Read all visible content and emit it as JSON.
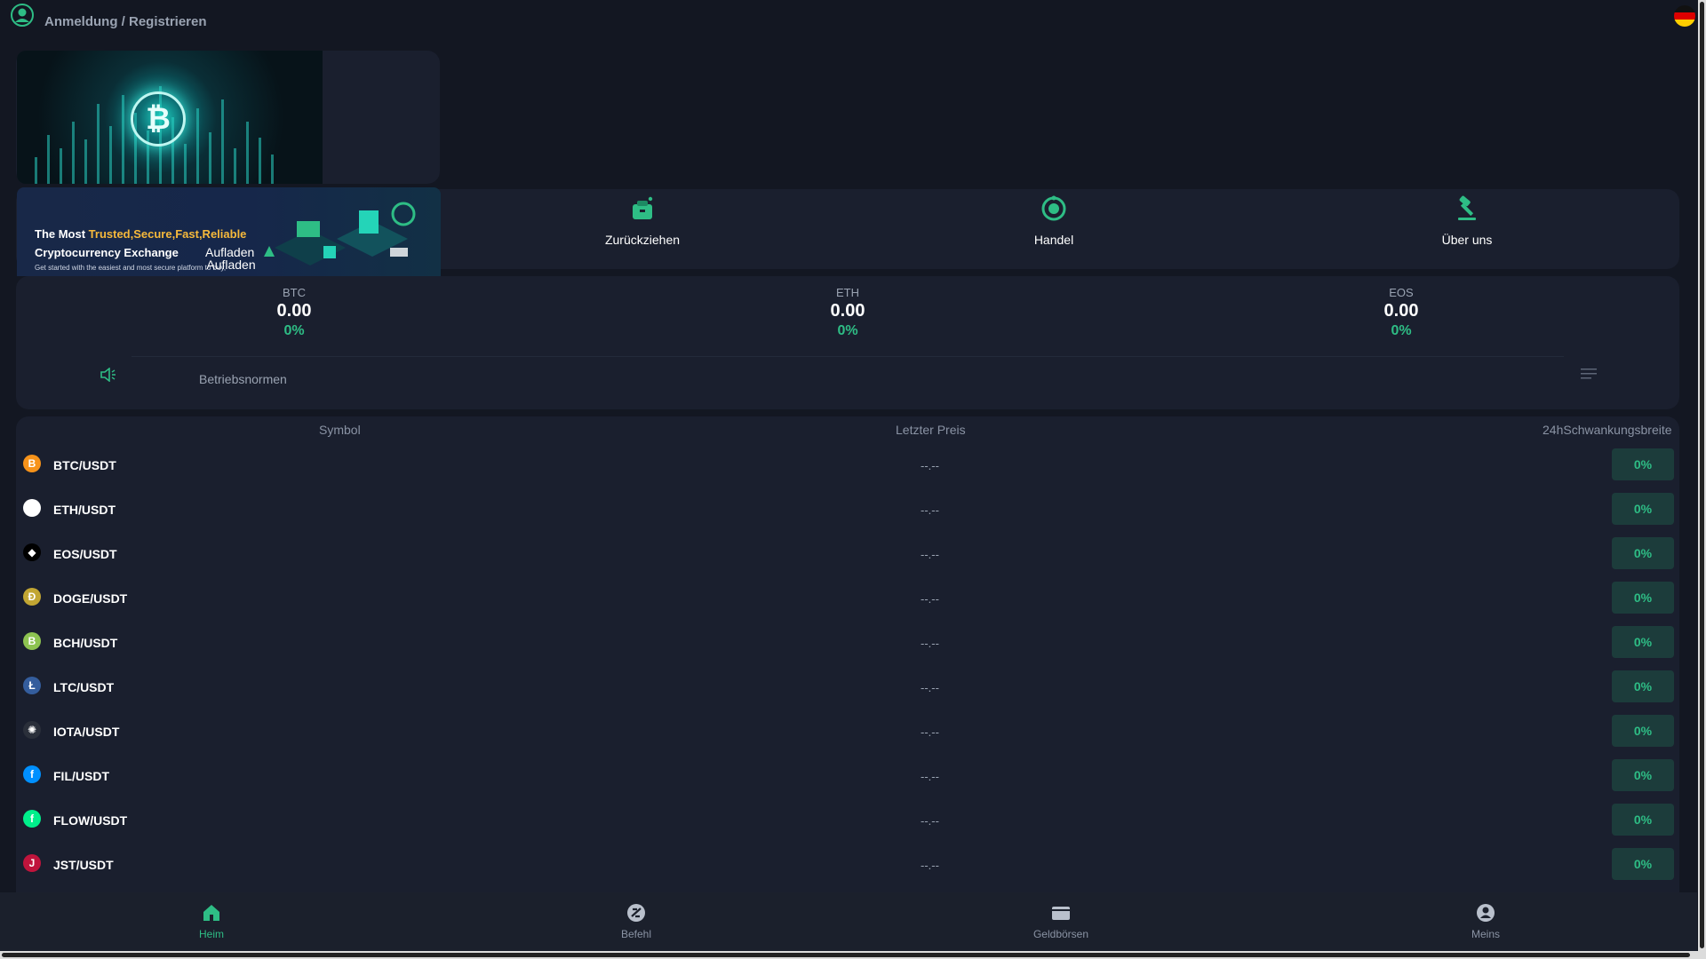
{
  "header": {
    "login_label": "Anmeldung / Registrieren",
    "avatar_icon": "user-circle-icon",
    "language_flag": "german-flag-icon"
  },
  "promo": {
    "line1_prefix": "The Most ",
    "line1_highlight": "Trusted,Secure,Fast,Reliable",
    "line2": "Cryptocurrency Exchange",
    "line3": "Get started with the easiest and most secure platform to buy,"
  },
  "quick_actions": [
    {
      "label": "Aufladen",
      "icon": "rocket-icon"
    },
    {
      "label": "Zurückziehen",
      "icon": "wallet-withdraw-icon"
    },
    {
      "label": "Handel",
      "icon": "trade-cycle-icon"
    },
    {
      "label": "Über uns",
      "icon": "hammer-icon"
    }
  ],
  "ticker": [
    {
      "symbol": "BTC",
      "price": "0.00",
      "change": "0%"
    },
    {
      "symbol": "ETH",
      "price": "0.00",
      "change": "0%"
    },
    {
      "symbol": "EOS",
      "price": "0.00",
      "change": "0%"
    }
  ],
  "notice": {
    "text": "Betriebsnormen",
    "icon": "speaker-icon",
    "menu_icon": "list-menu-icon"
  },
  "market": {
    "headers": {
      "symbol": "Symbol",
      "last_price": "Letzter Preis",
      "change": "24hSchwankungsbreite"
    },
    "rows": [
      {
        "pair": "BTC/USDT",
        "last": "--.--",
        "change": "0%",
        "icon": "btc-icon",
        "glyph": "B",
        "color": "#f7931a"
      },
      {
        "pair": "ETH/USDT",
        "last": "--.--",
        "change": "0%",
        "icon": "eth-icon",
        "glyph": "♦",
        "color": "#ffffff"
      },
      {
        "pair": "EOS/USDT",
        "last": "--.--",
        "change": "0%",
        "icon": "eos-icon",
        "glyph": "◆",
        "color": "#000000"
      },
      {
        "pair": "DOGE/USDT",
        "last": "--.--",
        "change": "0%",
        "icon": "doge-icon",
        "glyph": "Ð",
        "color": "#c2a633"
      },
      {
        "pair": "BCH/USDT",
        "last": "--.--",
        "change": "0%",
        "icon": "bch-icon",
        "glyph": "B",
        "color": "#8dc351"
      },
      {
        "pair": "LTC/USDT",
        "last": "--.--",
        "change": "0%",
        "icon": "ltc-icon",
        "glyph": "Ł",
        "color": "#345d9d"
      },
      {
        "pair": "IOTA/USDT",
        "last": "--.--",
        "change": "0%",
        "icon": "iota-icon",
        "glyph": "✺",
        "color": "#2a2f3a"
      },
      {
        "pair": "FIL/USDT",
        "last": "--.--",
        "change": "0%",
        "icon": "fil-icon",
        "glyph": "f",
        "color": "#0090ff"
      },
      {
        "pair": "FLOW/USDT",
        "last": "--.--",
        "change": "0%",
        "icon": "flow-icon",
        "glyph": "f",
        "color": "#00ef8b"
      },
      {
        "pair": "JST/USDT",
        "last": "--.--",
        "change": "0%",
        "icon": "jst-icon",
        "glyph": "J",
        "color": "#c0143c"
      }
    ]
  },
  "tabbar": [
    {
      "label": "Heim",
      "icon": "home-icon",
      "active": true
    },
    {
      "label": "Befehl",
      "icon": "order-icon",
      "active": false
    },
    {
      "label": "Geldbörsen",
      "icon": "wallet-icon",
      "active": false
    },
    {
      "label": "Meins",
      "icon": "profile-icon",
      "active": false
    }
  ],
  "colors": {
    "accent": "#2ebd85",
    "background": "#131722",
    "panel": "#1a1f2e"
  }
}
